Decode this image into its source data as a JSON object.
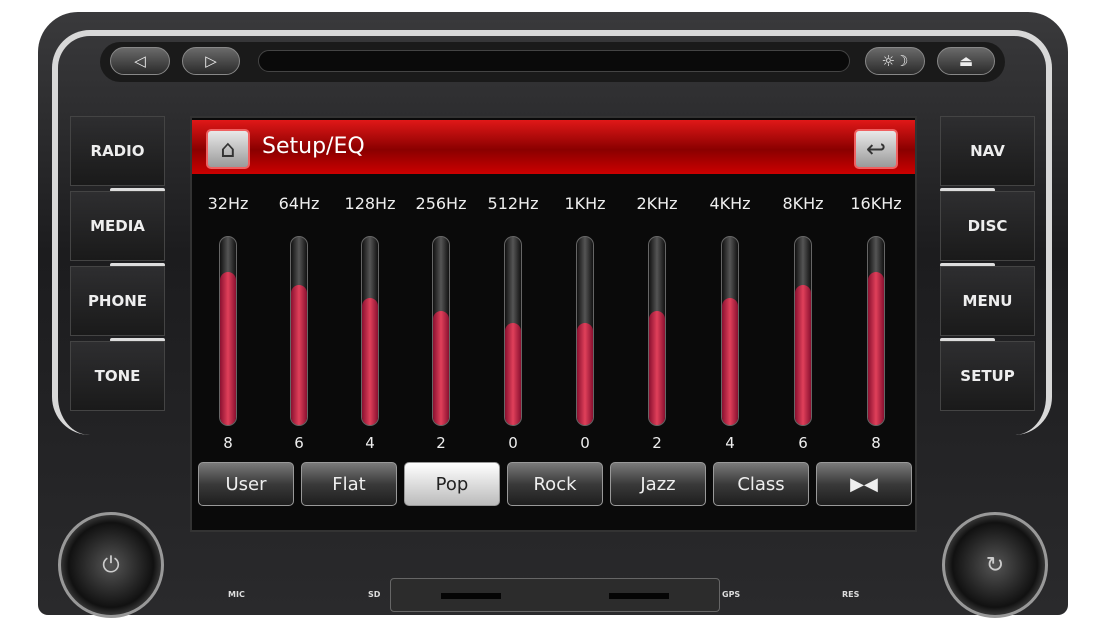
{
  "device": {
    "top_buttons": [
      {
        "name": "prev",
        "icon": "◁"
      },
      {
        "name": "next",
        "icon": "▷"
      },
      {
        "name": "brightness",
        "icon": "☼☽"
      },
      {
        "name": "eject",
        "icon": "⏏"
      }
    ],
    "left_buttons": [
      "RADIO",
      "MEDIA",
      "PHONE",
      "TONE"
    ],
    "right_buttons": [
      "NAV",
      "DISC",
      "MENU",
      "SETUP"
    ],
    "bottom_labels": {
      "mic": "MIC",
      "sd": "SD",
      "gps": "GPS",
      "res": "RES"
    }
  },
  "screen": {
    "title": "Setup/EQ",
    "home_icon": "home-icon",
    "back_icon": "back-arrow-icon",
    "accent": "#d01010",
    "bands": [
      {
        "freq": "32Hz",
        "value": 8
      },
      {
        "freq": "64Hz",
        "value": 6
      },
      {
        "freq": "128Hz",
        "value": 4
      },
      {
        "freq": "256Hz",
        "value": 2
      },
      {
        "freq": "512Hz",
        "value": 0
      },
      {
        "freq": "1KHz",
        "value": 0
      },
      {
        "freq": "2KHz",
        "value": 2
      },
      {
        "freq": "4KHz",
        "value": 4
      },
      {
        "freq": "8KHz",
        "value": 6
      },
      {
        "freq": "16KHz",
        "value": 8
      }
    ],
    "presets": [
      {
        "label": "User"
      },
      {
        "label": "Flat"
      },
      {
        "label": "Pop",
        "active": true
      },
      {
        "label": "Rock"
      },
      {
        "label": "Jazz"
      },
      {
        "label": "Class"
      },
      {
        "label": "▶◀",
        "icon": "balance-icon"
      }
    ]
  }
}
